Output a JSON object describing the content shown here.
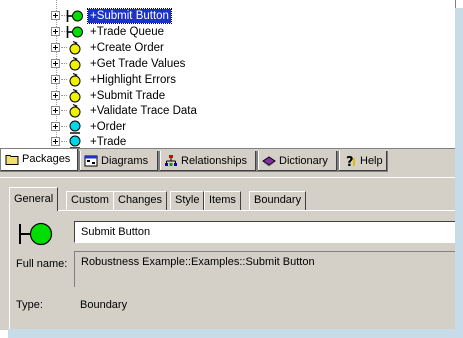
{
  "tree": {
    "items": [
      {
        "label": "+Submit Button",
        "icon": "boundary-icon",
        "selected": true
      },
      {
        "label": "+Trade Queue",
        "icon": "boundary-icon",
        "selected": false
      },
      {
        "label": "+Create Order",
        "icon": "control-icon",
        "selected": false
      },
      {
        "label": "+Get Trade Values",
        "icon": "control-icon",
        "selected": false
      },
      {
        "label": "+Highlight Errors",
        "icon": "control-icon",
        "selected": false
      },
      {
        "label": "+Submit Trade",
        "icon": "control-icon",
        "selected": false
      },
      {
        "label": "+Validate Trace Data",
        "icon": "control-icon",
        "selected": false
      },
      {
        "label": "+Order",
        "icon": "entity-icon",
        "selected": false
      },
      {
        "label": "+Trade",
        "icon": "entity-icon",
        "selected": false
      }
    ]
  },
  "browser_tabs": [
    {
      "label": "Packages",
      "icon": "folder-icon",
      "active": true
    },
    {
      "label": "Diagrams",
      "icon": "diagram-icon",
      "active": false
    },
    {
      "label": "Relationships",
      "icon": "hierarchy-icon",
      "active": false
    },
    {
      "label": "Dictionary",
      "icon": "book-icon",
      "active": false
    },
    {
      "label": "Help",
      "icon": "help-icon",
      "active": false
    }
  ],
  "properties": {
    "tabs": [
      "General",
      "Custom",
      "Changes",
      "Style",
      "Items",
      "Boundary"
    ],
    "active_tab": "General",
    "name_value": "Submit Button",
    "full_name_label": "Full name:",
    "full_name_value": "Robustness Example::Examples::Submit Button",
    "type_label": "Type:",
    "type_value": "Boundary",
    "icon": "boundary-icon"
  },
  "colors": {
    "selection": "#1c33c8",
    "boundary_fill": "#00dd00",
    "control_fill": "#f0f000",
    "entity_fill": "#00d8e8",
    "panel_bg": "#d4d0c8"
  }
}
